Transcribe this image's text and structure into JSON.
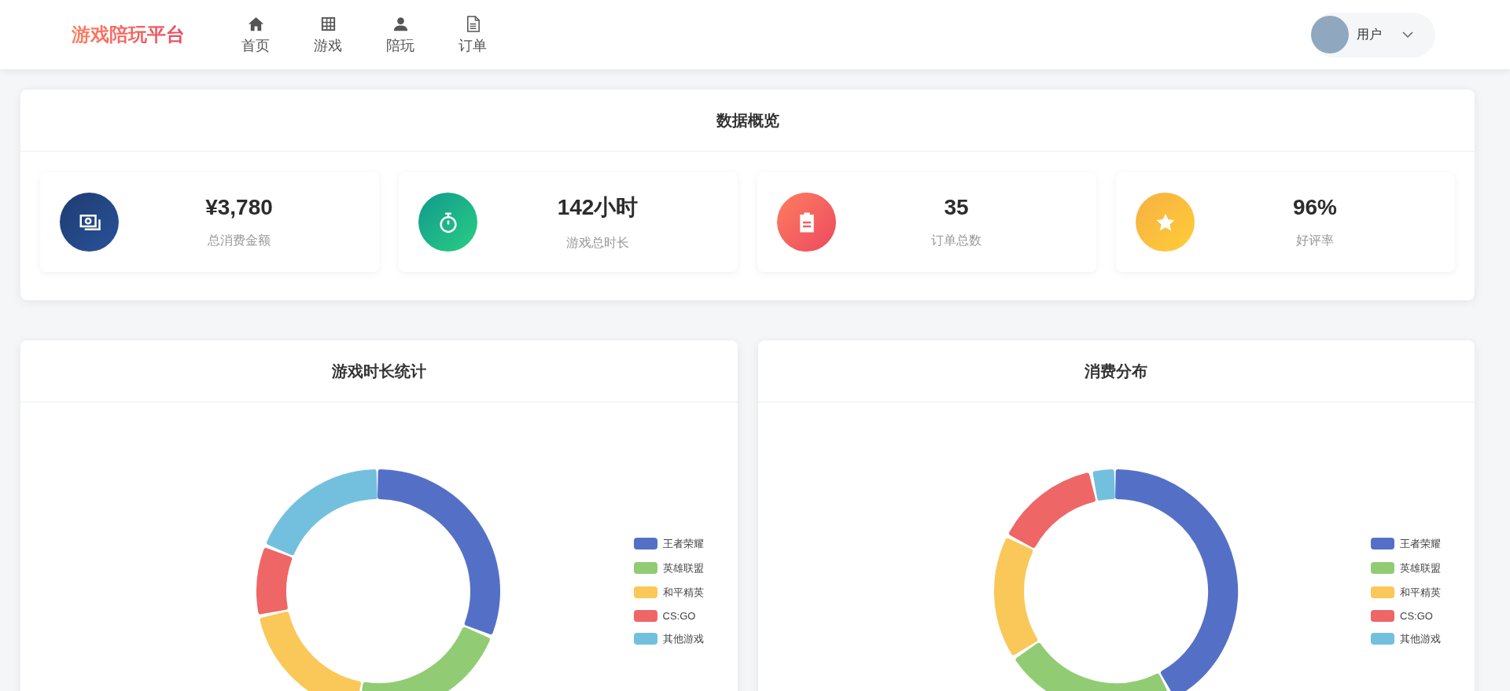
{
  "header": {
    "logo": "游戏陪玩平台",
    "nav": [
      {
        "label": "首页"
      },
      {
        "label": "游戏"
      },
      {
        "label": "陪玩"
      },
      {
        "label": "订单"
      }
    ],
    "user": {
      "name": "用户"
    }
  },
  "overview": {
    "title": "数据概览",
    "stats": [
      {
        "value": "¥3,780",
        "label": "总消费金额"
      },
      {
        "value": "142小时",
        "label": "游戏总时长"
      },
      {
        "value": "35",
        "label": "订单总数"
      },
      {
        "value": "96%",
        "label": "好评率"
      }
    ]
  },
  "charts": [
    {
      "title": "游戏时长统计",
      "legend": [
        {
          "label": "王者荣耀",
          "color": "#5470c6"
        },
        {
          "label": "英雄联盟",
          "color": "#91cc75"
        },
        {
          "label": "和平精英",
          "color": "#fac858"
        },
        {
          "label": "CS:GO",
          "color": "#ee6666"
        },
        {
          "label": "其他游戏",
          "color": "#73c0de"
        }
      ]
    },
    {
      "title": "消费分布",
      "legend": [
        {
          "label": "王者荣耀",
          "color": "#5470c6"
        },
        {
          "label": "英雄联盟",
          "color": "#91cc75"
        },
        {
          "label": "和平精英",
          "color": "#fac858"
        },
        {
          "label": "CS:GO",
          "color": "#ee6666"
        },
        {
          "label": "其他游戏",
          "color": "#73c0de"
        }
      ]
    }
  ]
}
